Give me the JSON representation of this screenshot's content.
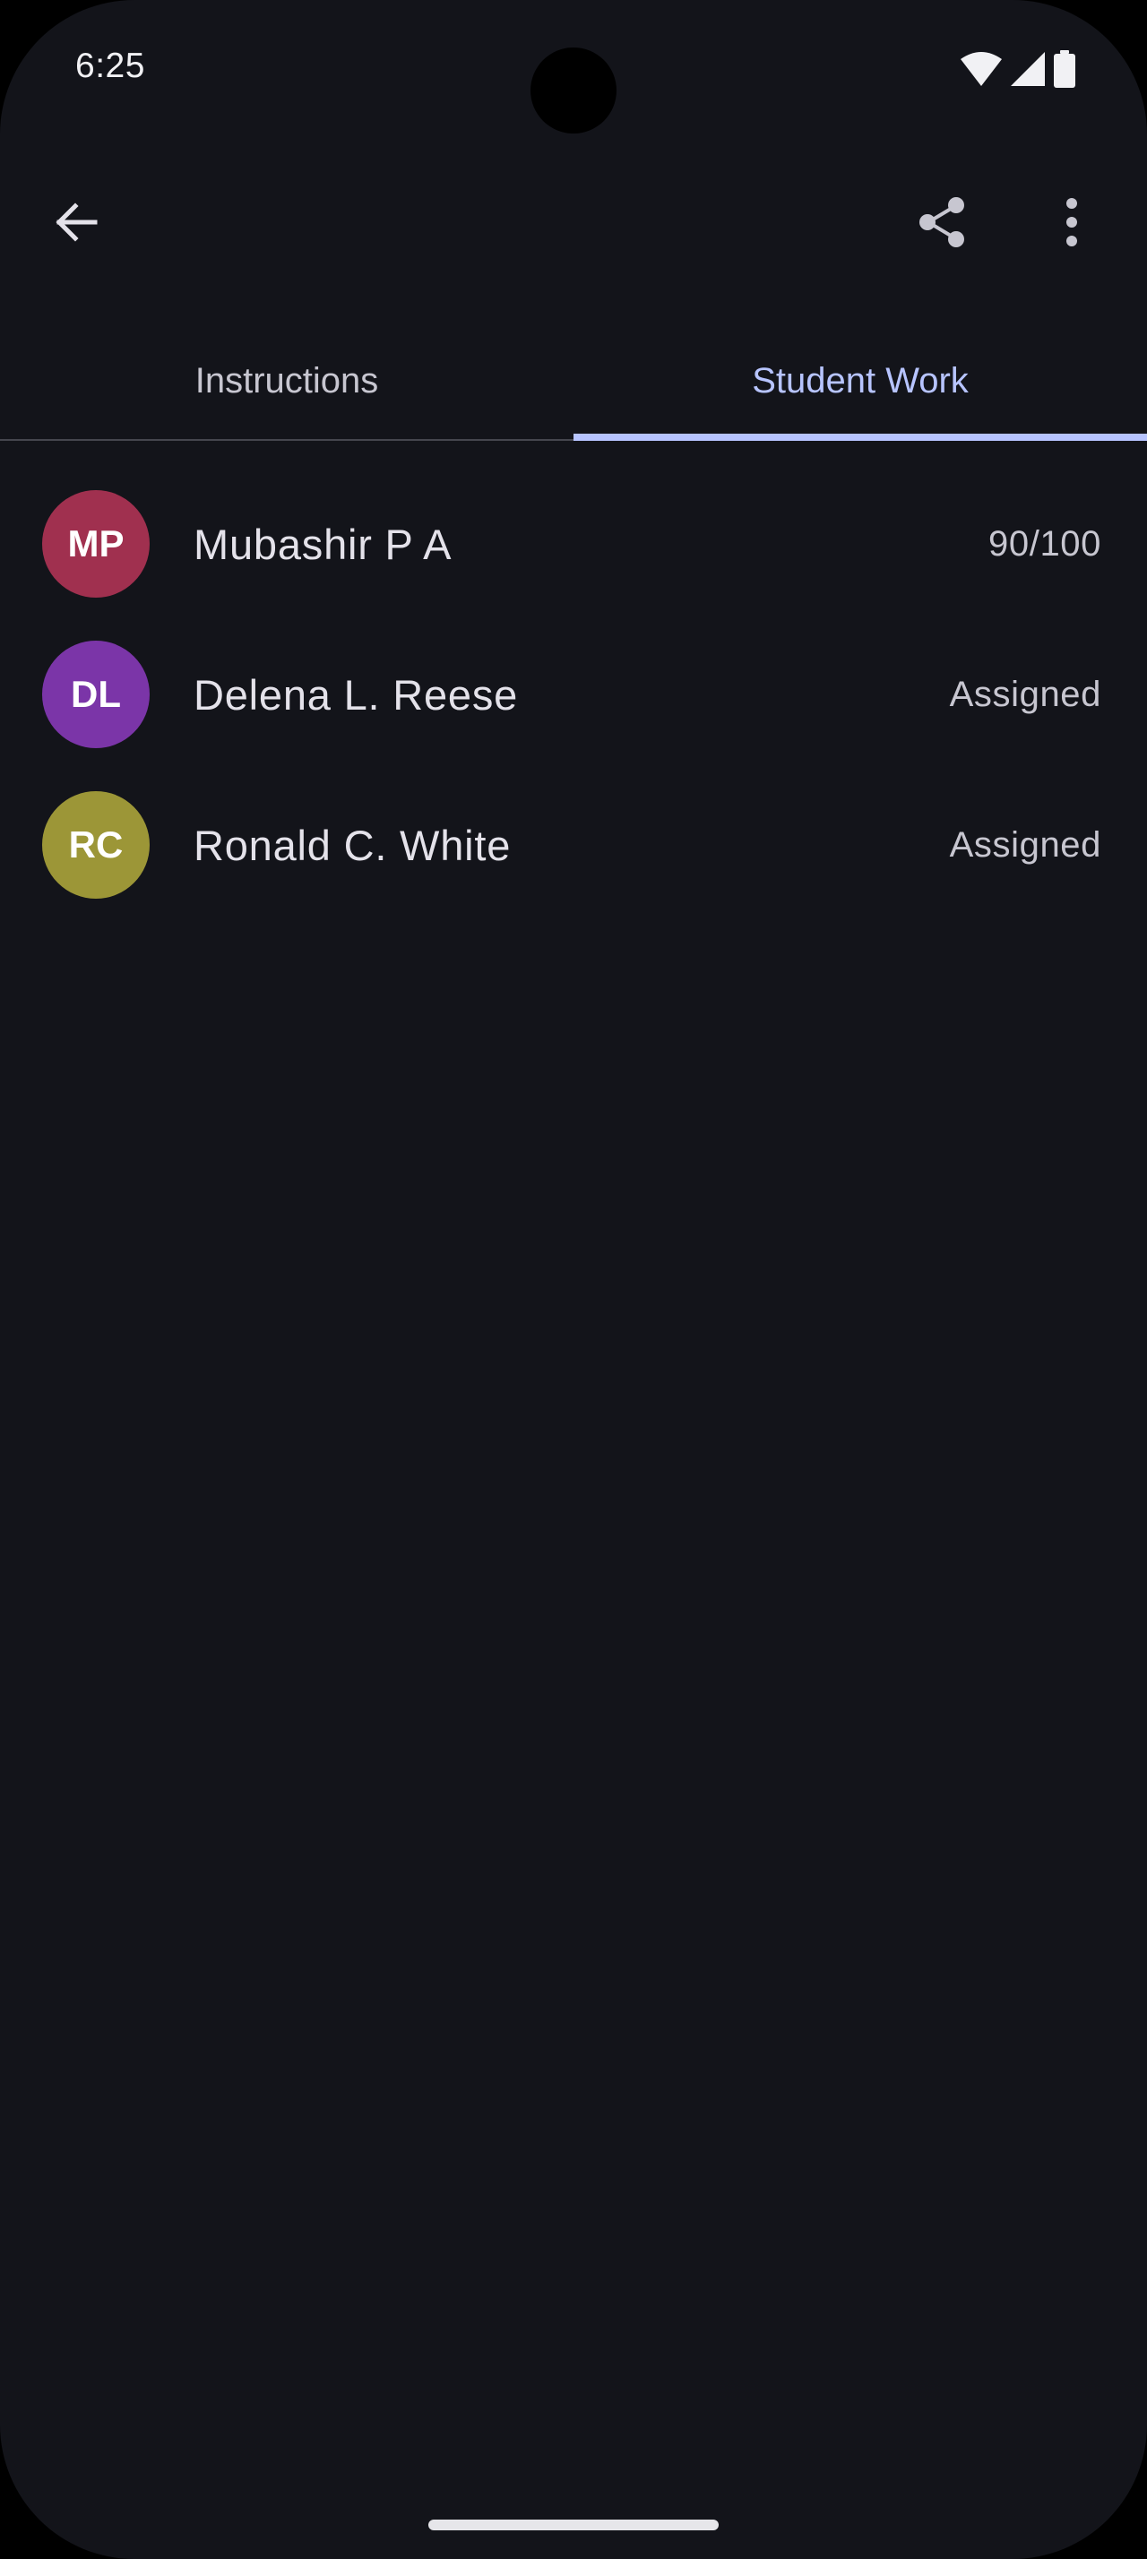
{
  "status_bar": {
    "time": "6:25",
    "icons": [
      "wifi-icon",
      "signal-icon",
      "battery-icon"
    ]
  },
  "app_bar": {
    "back_icon": "arrow-left-icon",
    "share_icon": "share-icon",
    "more_icon": "more-vert-icon"
  },
  "tabs": [
    {
      "label": "Instructions",
      "active": false
    },
    {
      "label": "Student Work",
      "active": true
    }
  ],
  "students": [
    {
      "initials": "MP",
      "name": "Mubashir P A",
      "status": "90/100",
      "avatar_color": "#a0304f"
    },
    {
      "initials": "DL",
      "name": "Delena L. Reese",
      "status": "Assigned",
      "avatar_color": "#7b35a8"
    },
    {
      "initials": "RC",
      "name": "Ronald C. White",
      "status": "Assigned",
      "avatar_color": "#9c9637"
    }
  ],
  "colors": {
    "background": "#13141a",
    "accent": "#b7c4ff",
    "text_primary": "#e4e2ea",
    "text_secondary": "#c7c6d0"
  }
}
